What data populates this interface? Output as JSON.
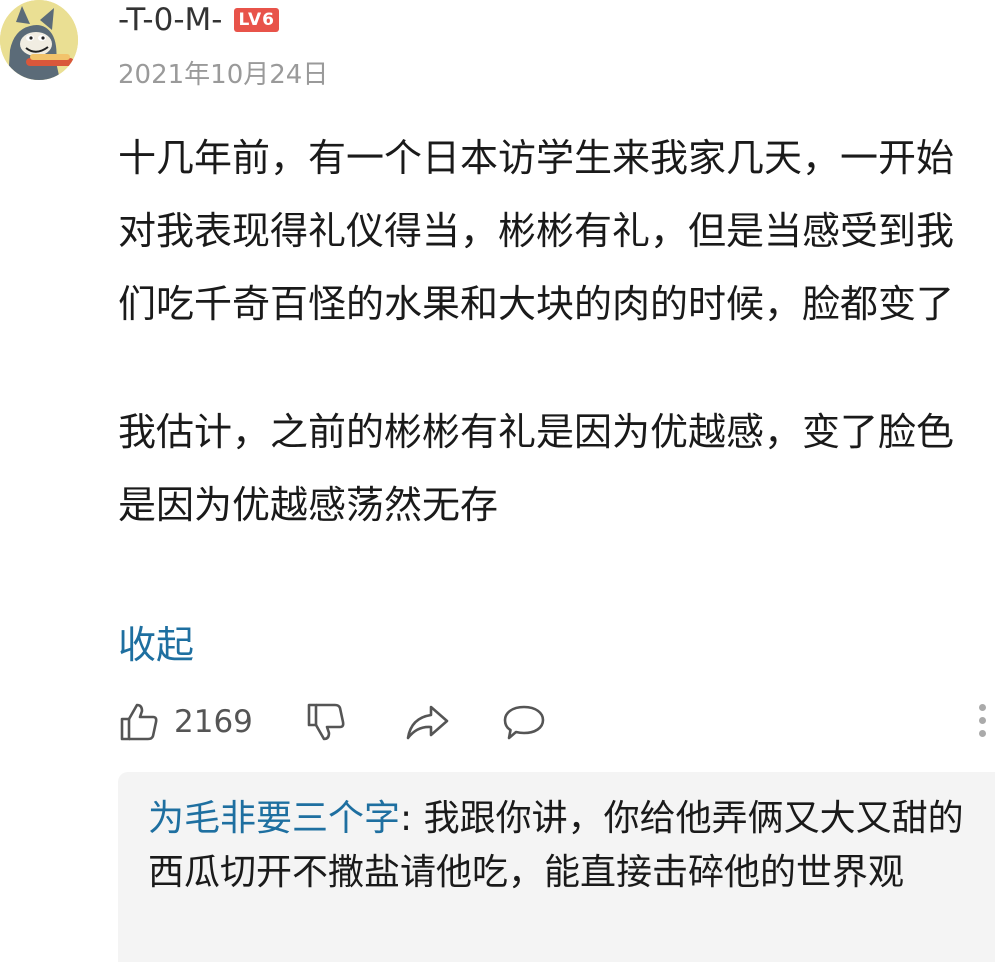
{
  "comment": {
    "username": "-T-0-M-",
    "level_badge": "LV6",
    "date": "2021年10月24日",
    "paragraphs": [
      "十几年前，有一个日本访学生来我家几天，一开始对我表现得礼仪得当，彬彬有礼，但是当感受到我们吃千奇百怪的水果和大块的肉的时候，脸都变了",
      "我估计，之前的彬彬有礼是因为优越感，变了脸色是因为优越感荡然无存"
    ],
    "collapse_label": "收起",
    "like_count": "2169"
  },
  "reply": {
    "author": "为毛非要三个字",
    "separator": ": ",
    "text": "我跟你讲，你给他弄俩又大又甜的西瓜切开不撒盐请他吃，能直接击碎他的世界观"
  },
  "colors": {
    "link": "#1e6fa0",
    "badge": "#e8534a",
    "reply_bg": "#f4f4f4"
  },
  "icons": [
    "avatar-image",
    "thumbs-up-icon",
    "thumbs-down-icon",
    "share-icon",
    "comment-icon",
    "more-icon"
  ]
}
